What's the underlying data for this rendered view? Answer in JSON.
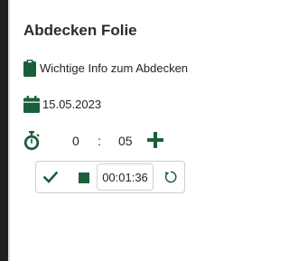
{
  "colors": {
    "accent": "#1a5f3a",
    "text": "#212529"
  },
  "card": {
    "title": "Abdecken Folie",
    "info": {
      "icon": "clipboard-icon",
      "text": "Wichtige Info zum Abdecken"
    },
    "date": {
      "icon": "calendar-icon",
      "text": "15.05.2023"
    },
    "timer_input": {
      "icon": "stopwatch-icon",
      "hours": "0",
      "separator": ":",
      "minutes": "05",
      "add_icon": "plus-icon"
    },
    "controls": {
      "confirm_icon": "check-icon",
      "stop_icon": "stop-icon",
      "elapsed": "00:01:36",
      "reset_icon": "reset-icon"
    }
  }
}
